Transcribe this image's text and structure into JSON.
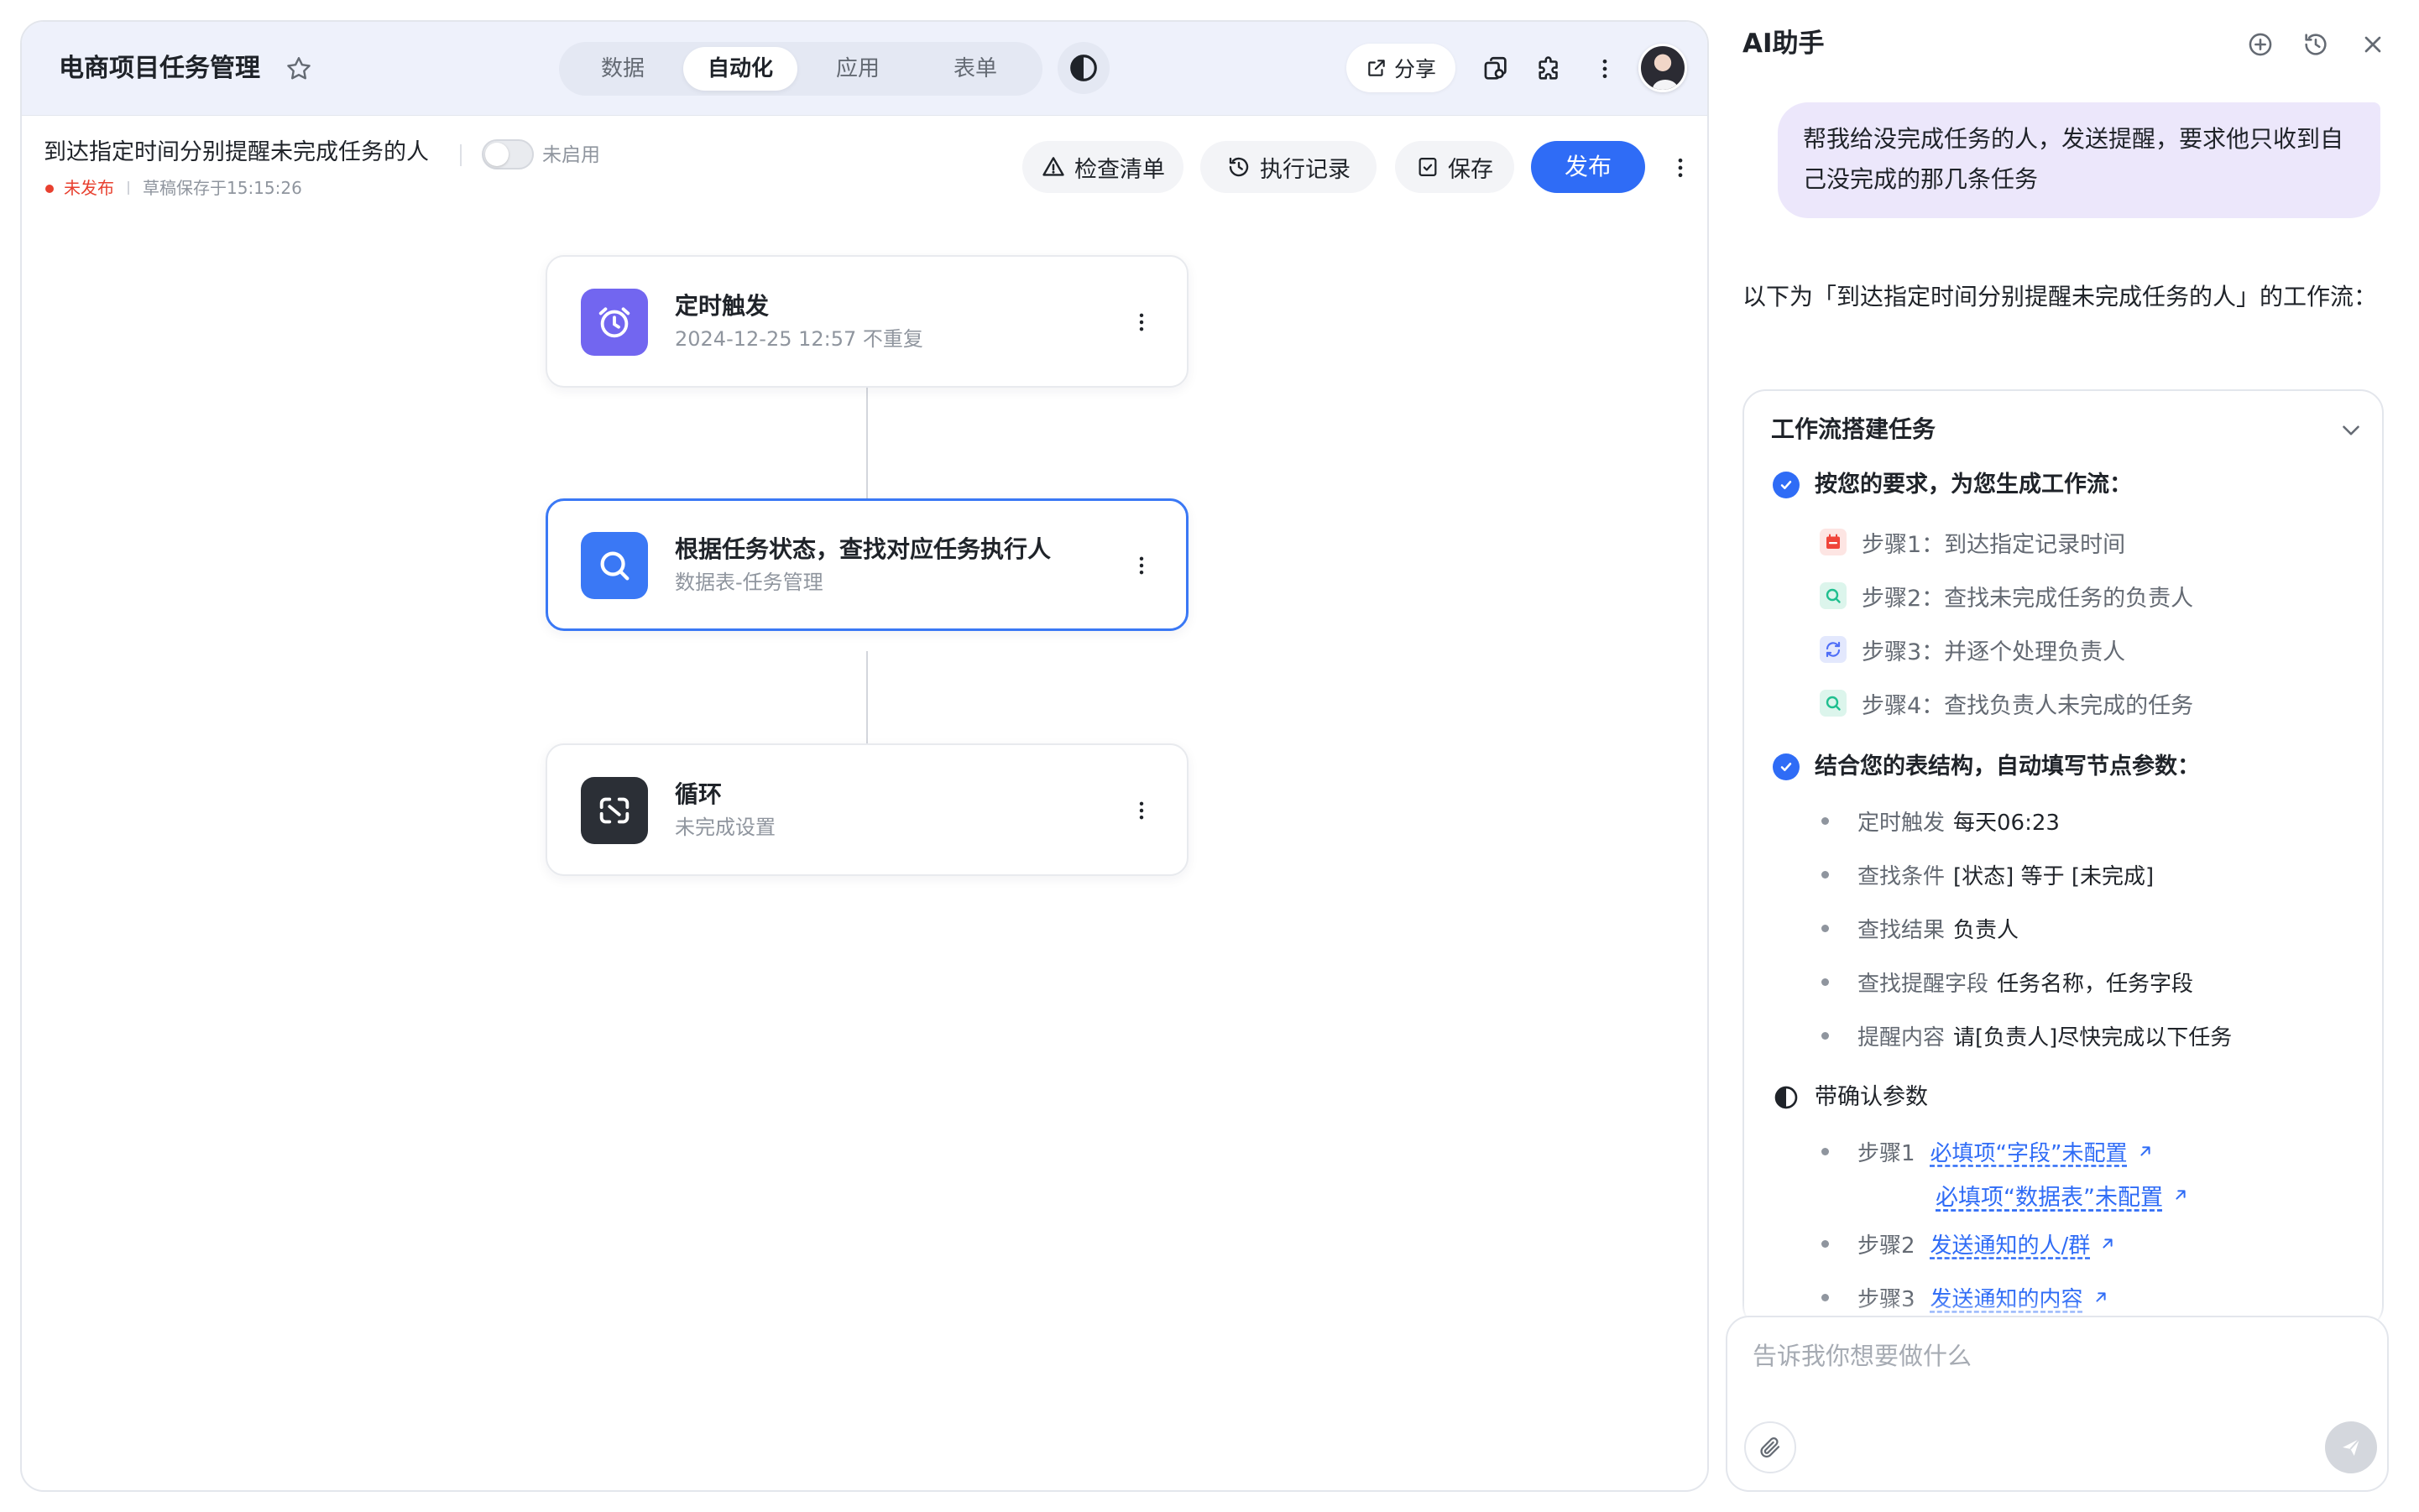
{
  "app": {
    "title": "电商项目任务管理",
    "tabs": [
      {
        "label": "数据",
        "active": false
      },
      {
        "label": "自动化",
        "active": true
      },
      {
        "label": "应用",
        "active": false
      },
      {
        "label": "表单",
        "active": false
      }
    ],
    "share_label": "分享",
    "icons": [
      "star-icon",
      "halfmoon-icon",
      "share-icon",
      "copy-icon",
      "plugin-icon",
      "more-vertical-icon",
      "avatar"
    ]
  },
  "workflow": {
    "title": "到达指定时间分别提醒未完成任务的人",
    "toggle_label": "未启用",
    "enabled": false,
    "status": "未发布",
    "saved_text": "草稿保存于15:15:26",
    "buttons": {
      "checklist": "检查清单",
      "history": "执行记录",
      "save": "保存",
      "publish": "发布"
    },
    "nodes": [
      {
        "title": "定时触发",
        "subtitle": "2024-12-25 12:57 不重复",
        "icon": "alarm-clock-icon",
        "icon_color": "#7266f0",
        "selected": false
      },
      {
        "title": "根据任务状态，查找对应任务执行人",
        "subtitle": "数据表-任务管理",
        "icon": "search-icon",
        "icon_color": "#3a78f5",
        "selected": true
      },
      {
        "title": "循环",
        "subtitle": "未完成设置",
        "icon": "loop-icon",
        "icon_color": "#2b2f36",
        "selected": false
      }
    ]
  },
  "assistant": {
    "title": "AI助手",
    "user_message": "帮我给没完成任务的人，发送提醒，要求他只收到自己没完成的那几条任务",
    "intro": "以下为「到达指定时间分别提醒未完成任务的人」的工作流：",
    "card_title": "工作流搭建任务",
    "section1": {
      "title": "按您的要求，为您生成工作流：",
      "steps": [
        {
          "label": "步骤1：到达指定记录时间",
          "icon": "calendar-icon",
          "color": "#f0443a"
        },
        {
          "label": "步骤2：查找未完成任务的负责人",
          "icon": "search-icon",
          "color": "#1fbf8f"
        },
        {
          "label": "步骤3：并逐个处理负责人",
          "icon": "loop-icon",
          "color": "#4f6ef7"
        },
        {
          "label": "步骤4：查找负责人未完成的任务",
          "icon": "search-icon",
          "color": "#1fbf8f"
        }
      ]
    },
    "section2": {
      "title": "结合您的表结构，自动填写节点参数：",
      "params": [
        {
          "key": "定时触发",
          "value": "每天06:23"
        },
        {
          "key": "查找条件",
          "value": "[状态] 等于 [未完成]"
        },
        {
          "key": "查找结果",
          "value": "负责人"
        },
        {
          "key": "查找提醒字段",
          "value": "任务名称，任务字段"
        },
        {
          "key": "提醒内容",
          "value": "请[负责人]尽快完成以下任务"
        }
      ]
    },
    "section3": {
      "title": "带确认参数",
      "items": [
        {
          "step": "步骤1",
          "links": [
            "必填项“字段”未配置",
            "必填项“数据表”未配置"
          ]
        },
        {
          "step": "步骤2",
          "links": [
            "发送通知的人/群"
          ]
        },
        {
          "step": "步骤3",
          "links": [
            "发送通知的内容"
          ]
        }
      ]
    },
    "input_placeholder": "告诉我你想要做什么"
  },
  "colors": {
    "accent": "#2f6cf6",
    "danger": "#e8402f",
    "user_bubble": "#ece7fb",
    "header_bg": "#eef1fb"
  }
}
